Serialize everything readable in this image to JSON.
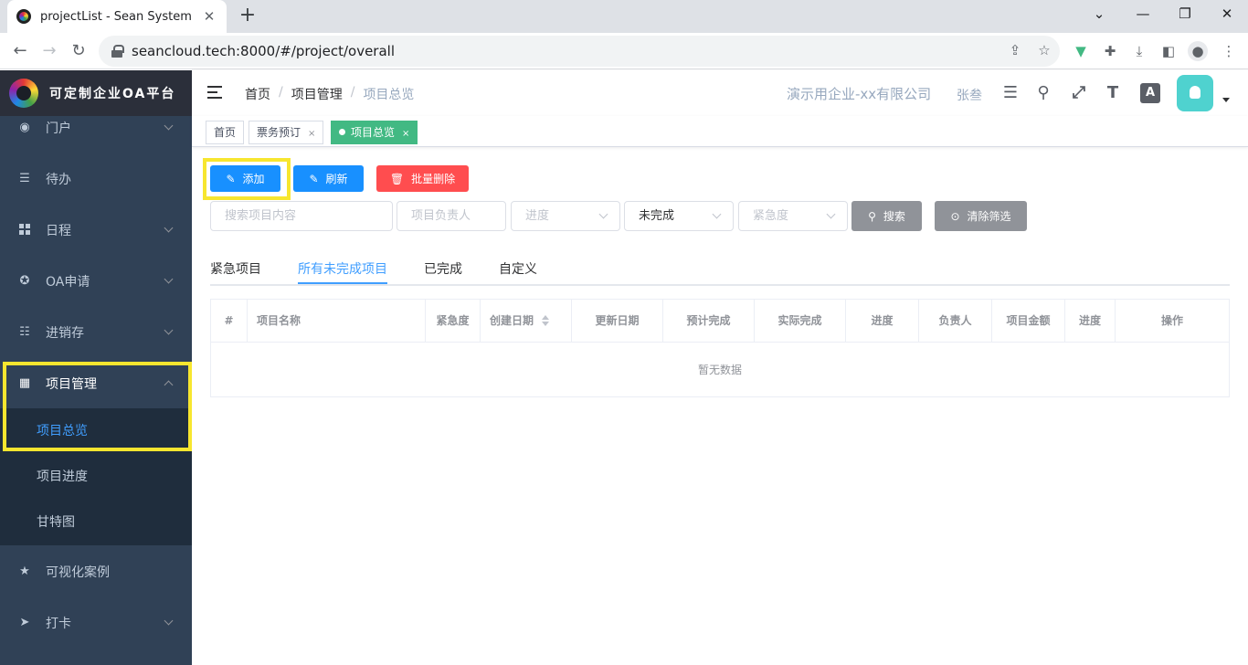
{
  "browser": {
    "tab_title": "projectList - Sean System",
    "tab_close": "✕",
    "new_tab": "+",
    "url": "seancloud.tech:8000/#/project/overall"
  },
  "sidebar": {
    "logo_text": "可定制企业OA平台",
    "items": [
      {
        "label": "门户"
      },
      {
        "label": "待办"
      },
      {
        "label": "日程"
      },
      {
        "label": "OA申请"
      },
      {
        "label": "进销存"
      },
      {
        "label": "项目管理"
      },
      {
        "label": "可视化案例"
      },
      {
        "label": "打卡"
      }
    ],
    "submenu": [
      {
        "label": "项目总览"
      },
      {
        "label": "项目进度"
      },
      {
        "label": "甘特图"
      }
    ]
  },
  "header": {
    "breadcrumbs": [
      "首页",
      "项目管理",
      "项目总览"
    ],
    "breadcrumb_sep": "/",
    "company": "演示用企业-xx有限公司",
    "username": "张叁"
  },
  "tagsview": {
    "tags": [
      {
        "label": "首页"
      },
      {
        "label": "票务预订",
        "close": "×"
      },
      {
        "label": "项目总览",
        "close": "×"
      }
    ]
  },
  "actions": {
    "add": "添加",
    "refresh": "刷新",
    "batch_delete": "批量删除"
  },
  "filters": {
    "search_placeholder": "搜索项目内容",
    "owner_placeholder": "项目负责人",
    "progress_placeholder": "进度",
    "status_value": "未完成",
    "urgency_placeholder": "紧急度",
    "search_button": "搜索",
    "clear_button": "清除筛选"
  },
  "tabs": [
    "紧急项目",
    "所有未完成项目",
    "已完成",
    "自定义"
  ],
  "table": {
    "columns": [
      "#",
      "项目名称",
      "紧急度",
      "创建日期",
      "更新日期",
      "预计完成",
      "实际完成",
      "进度",
      "负责人",
      "项目金额",
      "进度",
      "操作"
    ],
    "empty_text": "暂无数据"
  },
  "colors": {
    "sidebar_bg": "#304156",
    "primary": "#1890ff",
    "danger": "#ff4d4f",
    "active_tag": "#42b983",
    "highlight": "#f7e62f"
  }
}
